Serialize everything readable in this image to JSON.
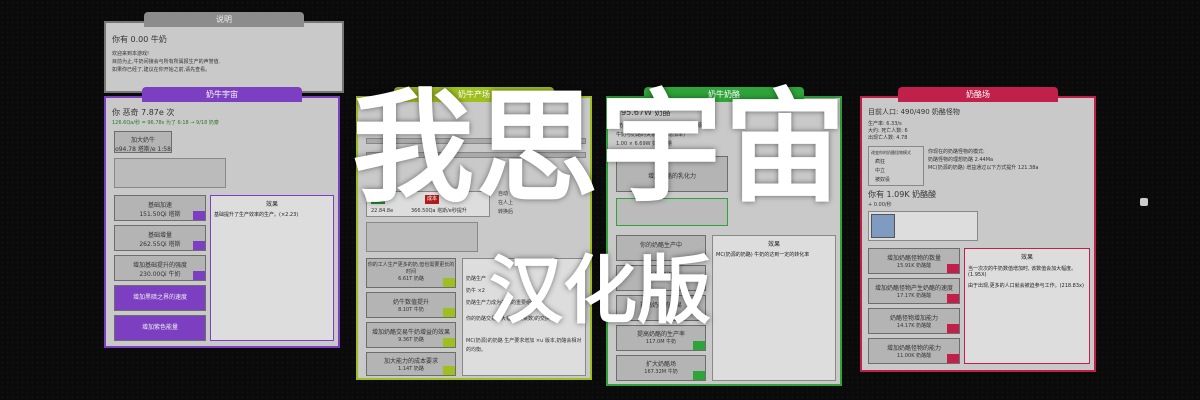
{
  "top_panel": {
    "tab": "说明",
    "money_line": "你有 0.00 牛奶",
    "intro": [
      "欢迎来到本游戏!",
      "目前为止,牛奶间接会与所有所属报生产的声誉值.",
      "如果你已经了,建议在你开始之前,请先查看。"
    ]
  },
  "panel1": {
    "tab": "奶牛宇宙",
    "currency": "你 恶奇 7.87e 次",
    "rate": "126.6Qa/秒 = 96.78s 为了 6:18 → 9/18 奶泰",
    "upgrade_box": [
      "加大奶牛",
      "o94.78 塔斯/e 1:58"
    ],
    "buttons": [
      "基础加速",
      "基础增量",
      "增加基础提升的强度",
      "增加黑暗之界的速度",
      "增加紫色能量"
    ],
    "costs": [
      "151.50Qi 塔斯",
      "262.55Qi 塔斯",
      "230.00Qi 牛奶",
      "",
      ""
    ],
    "effect_title": "效果",
    "effect_text": "基础提升了生产效率的生产。(×2.23)"
  },
  "panel2": {
    "tab": "奶牛产场",
    "items": [
      "加速",
      "成本"
    ],
    "values": [
      "22.84.8e",
      "366.50Qa 塔斯/e秒提升"
    ],
    "options": [
      "自动",
      "在人上",
      "转换后"
    ],
    "buttons": [
      "你的工人生产更多的奶,但也需要更长的时间",
      "奶牛数值提升",
      "增加奶酪交易牛奶增益的效果",
      "加大能力的成本要求"
    ],
    "costs": [
      "6.61T 奶酪",
      "8.10T 牛奶",
      "9.36T 奶酪",
      "1.14T 奶酪"
    ],
    "notes": [
      "奶酪生产",
      "奶牛 ×2",
      "奶酪生产力成为牛奶的重要组件",
      "你的奶酪交易率大幅增加(乘数)的交换率",
      "MC(奶源)的奶酪 生产要求增加 ×u 版本,奶酪会相对的均衡。"
    ]
  },
  "panel3": {
    "tab": "奶牛奶酪",
    "heading": "195.67W 奶酪",
    "lines": [
      "(奶源的成本)乘以你的奶牛产值。(奶源的)",
      "牛奶与奶酪的关系(产值增加率)",
      "1.00 × 6.69W 奶酪的量"
    ],
    "button": "增加奶酪的乳化力",
    "buttons": [
      "你的奶酪生产中",
      "MC 奶源奶酪",
      "提高奶酪的交易",
      "提高奶酪的生产率",
      "扩大奶酪场"
    ],
    "costs": [
      "",
      "",
      "",
      "117.0M 牛奶",
      "167.32M 牛奶"
    ],
    "effect_title": "效果",
    "effect_text": "MC(奶源的奶酪) 牛奶的达到一定的转化率"
  },
  "panel4": {
    "tab": "奶酪场",
    "population": "目前人口: 490/490 奶酪怪物",
    "lines": [
      "生产率: 6.33/s",
      "大约: 死亡人数: 6",
      "出现亡人数: 4.78"
    ],
    "options_title": "改变你的奶酪怪物模式",
    "options": [
      "疯狂",
      "中立",
      "被奴役"
    ],
    "mode_text": [
      "你现在的奶酪怪物的模式:",
      "奶酪怪物的理想奶酪 2.44Ma",
      "MC(奶源的奶酪) 增益通过以下方式提升 121.38a"
    ],
    "currency": "你有 1.09K 奶酪酸",
    "currency_rate": "+ 0.00/秒",
    "buttons": [
      "增加奶酪怪物的数量",
      "增加奶酪怪物产生奶酪的速度",
      "奶酪怪物增加能力",
      "增加奶酪怪物的能力"
    ],
    "costs": [
      "15.91K 奶酪酸",
      "17.17K 奶酪酸",
      "14.17K 奶酪酸",
      "11.00K 奶酪酸"
    ],
    "effect_title": "效果",
    "effects": [
      "当一次次的牛奶数值增加时, 该数值会加大幅度。(1.95X)",
      "由于出现,更多的人口就会被迫参与工作。(218.83x)"
    ]
  },
  "overlay": {
    "title": "我思宇宙",
    "subtitle": "汉化版"
  },
  "colors": {
    "purple": "#7d3fc2",
    "lime": "#9fbe20",
    "green": "#2fa43a",
    "pink": "#c0204a"
  }
}
